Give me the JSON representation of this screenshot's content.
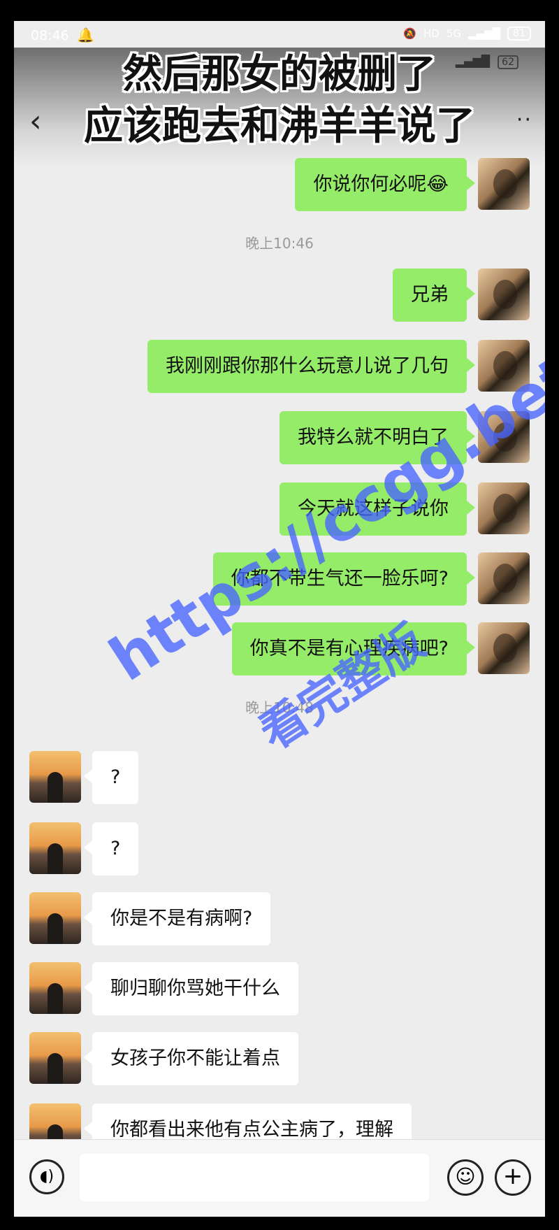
{
  "status": {
    "time": "08:46",
    "battery": "81",
    "net": "5G",
    "hd": "HD"
  },
  "header": {
    "caption_line1": "然后那女的被删了",
    "caption_line2": "应该跑去和沸羊羊说了",
    "inner_battery": "62"
  },
  "messages": [
    {
      "from": "me",
      "text": "你说你何必呢😂"
    },
    {
      "timestamp": "晚上10:46"
    },
    {
      "from": "me",
      "text": "兄弟"
    },
    {
      "from": "me",
      "text": "我刚刚跟你那什么玩意儿说了几句"
    },
    {
      "from": "me",
      "text": "我特么就不明白了"
    },
    {
      "from": "me",
      "text": "今天就这样子说你"
    },
    {
      "from": "me",
      "text": "你都不带生气还一脸乐呵?"
    },
    {
      "from": "me",
      "text": "你真不是有心理疾病吧?"
    },
    {
      "timestamp": "晚上10:48"
    },
    {
      "from": "them",
      "text": "?"
    },
    {
      "from": "them",
      "text": "?"
    },
    {
      "from": "them",
      "text": "你是不是有病啊?"
    },
    {
      "from": "them",
      "text": "聊归聊你骂她干什么"
    },
    {
      "from": "them",
      "text": "女孩子你不能让着点"
    },
    {
      "from": "them",
      "text": "你都看出来他有点公主病了，理解"
    }
  ],
  "watermark": {
    "line1": "https://ccgg.bet",
    "line2": "看完整版"
  },
  "icons": {
    "back": "back-arrow-icon",
    "more": "more-icon",
    "voice": "voice-icon",
    "emoji": "emoji-icon",
    "plus": "plus-icon"
  }
}
